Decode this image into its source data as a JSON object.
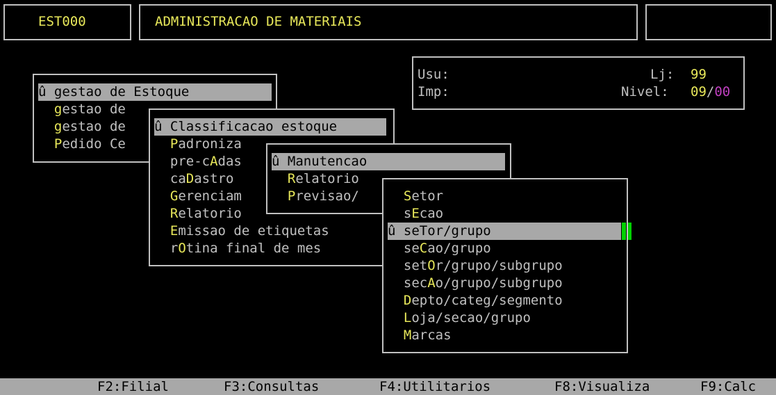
{
  "header": {
    "program_code": "EST000",
    "title": "ADMINISTRACAO DE MATERIAIS",
    "right_box": ""
  },
  "info": {
    "usu_label": "Usu:",
    "imp_label": "Imp:",
    "loja_label": "Lj:",
    "loja_value": "99",
    "nivel_label": "Nivel:",
    "nivel_value_a": "09",
    "nivel_sep": "/",
    "nivel_value_b": "00"
  },
  "menu1": {
    "items": [
      {
        "prefix": "û ",
        "hot": "g",
        "rest": "estao de Estoque",
        "selected": true
      },
      {
        "prefix": "  ",
        "hot": "g",
        "rest": "estao de",
        "selected": false
      },
      {
        "prefix": "  ",
        "hot": "g",
        "rest": "estao de",
        "selected": false
      },
      {
        "prefix": "  ",
        "hot": "P",
        "rest": "edido Ce",
        "selected": false
      }
    ]
  },
  "menu2": {
    "items": [
      {
        "before": "û ",
        "hot": "C",
        "after": "lassificacao estoque",
        "selected": true
      },
      {
        "before": "  ",
        "hot": "P",
        "after": "adroniza",
        "selected": false
      },
      {
        "before": "  pre-c",
        "hot": "A",
        "after": "das",
        "selected": false
      },
      {
        "before": "  ca",
        "hot": "D",
        "after": "astro",
        "selected": false
      },
      {
        "before": "  ",
        "hot": "G",
        "after": "erenciam",
        "selected": false
      },
      {
        "before": "  ",
        "hot": "R",
        "after": "elatorio",
        "selected": false
      },
      {
        "before": "  ",
        "hot": "E",
        "after": "missao de etiquetas",
        "selected": false
      },
      {
        "before": "  r",
        "hot": "O",
        "after": "tina final de mes",
        "selected": false
      }
    ]
  },
  "menu3": {
    "items": [
      {
        "before": "û ",
        "hot": "M",
        "after": "anutencao",
        "selected": true
      },
      {
        "before": "  ",
        "hot": "R",
        "after": "elatorio",
        "selected": false
      },
      {
        "before": "  ",
        "hot": "P",
        "after": "revisao/",
        "selected": false
      }
    ]
  },
  "menu4": {
    "items": [
      {
        "before": "  ",
        "hot": "S",
        "after": "etor",
        "selected": false
      },
      {
        "before": "  s",
        "hot": "E",
        "after": "cao",
        "selected": false
      },
      {
        "before": "û se",
        "hot": "T",
        "after": "or/grupo",
        "selected": true
      },
      {
        "before": "  se",
        "hot": "C",
        "after": "ao/grupo",
        "selected": false
      },
      {
        "before": "  set",
        "hot": "O",
        "after": "r/grupo/subgrupo",
        "selected": false
      },
      {
        "before": "  sec",
        "hot": "A",
        "after": "o/grupo/subgrupo",
        "selected": false
      },
      {
        "before": "  ",
        "hot": "D",
        "after": "epto/categ/segmento",
        "selected": false
      },
      {
        "before": "  ",
        "hot": "L",
        "after": "oja/secao/grupo",
        "selected": false
      },
      {
        "before": "  ",
        "hot": "M",
        "after": "arcas",
        "selected": false
      }
    ]
  },
  "function_keys": [
    "F2:Filial",
    "F3:Consultas",
    "F4:Utilitarios",
    "F8:Visualiza",
    "F9:Calc"
  ],
  "colors": {
    "background": "#000000",
    "text": "#c0c0c0",
    "accent_yellow": "#e8e85a",
    "selection_bg": "#a8a8a8",
    "nivel_b": "#c040c0",
    "cursor": "#00d000"
  }
}
